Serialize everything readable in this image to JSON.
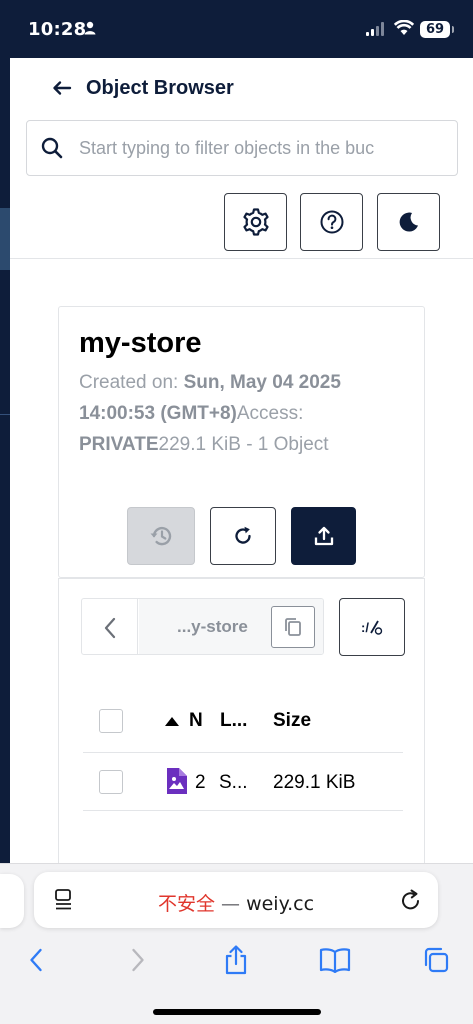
{
  "status_bar": {
    "time": "10:28",
    "battery": "69"
  },
  "header": {
    "title": "Object Browser"
  },
  "search": {
    "placeholder": "Start typing to filter objects in the buc"
  },
  "toolbar": {
    "icons": [
      "gear-icon",
      "help-icon",
      "moon-icon"
    ]
  },
  "bucket": {
    "name": "my-store",
    "created_label": "Created on: ",
    "created_value": "Sun, May 04 2025 14:00:53 (GMT+8)",
    "access_label": "Access: ",
    "access_value": "PRIVATE",
    "size_summary": "229.1 KiB - 1 Object"
  },
  "path": {
    "current": "...y-store",
    "edit_label": ":/"
  },
  "table": {
    "headers": {
      "name": "N",
      "last_modified": "L...",
      "size": "Size"
    },
    "rows": [
      {
        "name": "2",
        "last_modified": "S...",
        "size": "229.1 KiB",
        "icon": "image-file-icon"
      }
    ]
  },
  "browser": {
    "insecure_label": "不安全",
    "separator": " — ",
    "domain": "weiy.cc"
  },
  "colors": {
    "navy": "#0e1d3a",
    "file_icon": "#6b2fbf",
    "insecure": "#e0362c",
    "safari_blue": "#2f7bf6"
  }
}
